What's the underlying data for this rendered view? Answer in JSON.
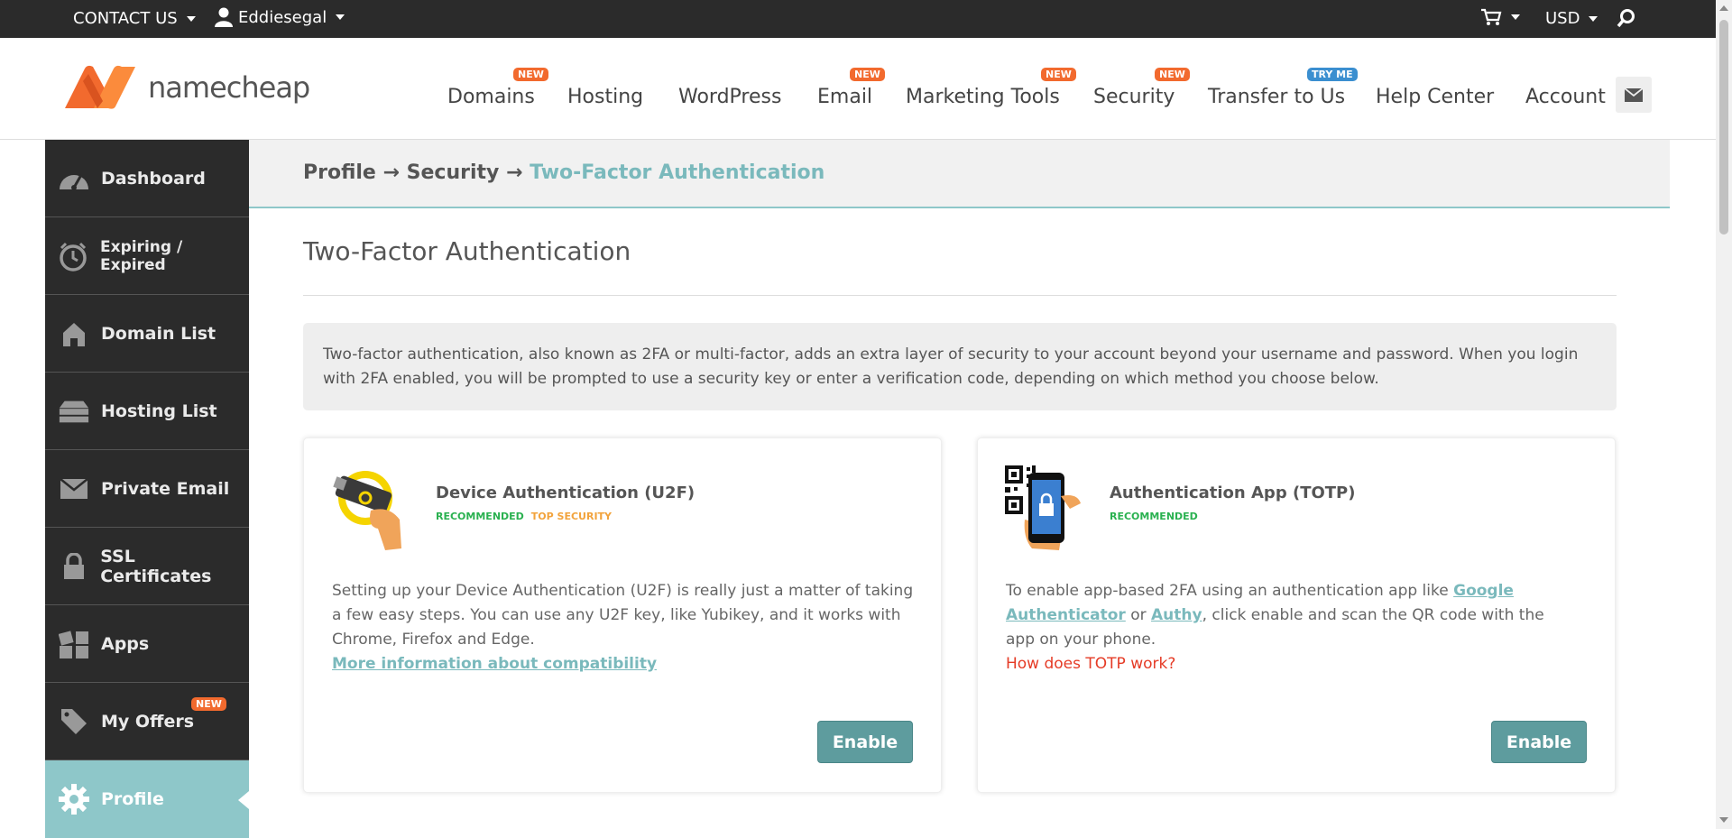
{
  "topbar": {
    "contact": "CONTACT US",
    "user": "Eddiesegal",
    "currency": "USD"
  },
  "brand": {
    "name": "namecheap"
  },
  "nav": [
    {
      "label": "Domains",
      "badge": "NEW"
    },
    {
      "label": "Hosting",
      "badge": ""
    },
    {
      "label": "WordPress",
      "badge": ""
    },
    {
      "label": "Email",
      "badge": "NEW"
    },
    {
      "label": "Marketing Tools",
      "badge": "NEW"
    },
    {
      "label": "Security",
      "badge": "NEW"
    },
    {
      "label": "Transfer to Us",
      "badge": "TRY ME"
    },
    {
      "label": "Help Center",
      "badge": ""
    },
    {
      "label": "Account",
      "badge": ""
    }
  ],
  "sidebar": {
    "items": [
      {
        "label": "Dashboard",
        "icon": "speedometer-icon"
      },
      {
        "label": "Expiring / Expired",
        "icon": "timer-icon"
      },
      {
        "label": "Domain List",
        "icon": "home-icon"
      },
      {
        "label": "Hosting List",
        "icon": "server-icon"
      },
      {
        "label": "Private Email",
        "icon": "envelope-icon"
      },
      {
        "label": "SSL Certificates",
        "icon": "lock-icon"
      },
      {
        "label": "Apps",
        "icon": "apps-icon"
      },
      {
        "label": "My Offers",
        "icon": "tag-icon",
        "badge": "NEW"
      },
      {
        "label": "Profile",
        "icon": "gear-icon"
      }
    ]
  },
  "breadcrumb": {
    "profile": "Profile",
    "security": "Security",
    "current": "Two-Factor Authentication",
    "arrow": "→"
  },
  "main": {
    "title": "Two-Factor Authentication",
    "intro": "Two-factor authentication, also known as 2FA or multi-factor, adds an extra layer of security to your account beyond your username and password. When you login with 2FA enabled, you will be prompted to use a security key or enter a verification code, depending on which method you choose below."
  },
  "cards": {
    "u2f": {
      "title": "Device Authentication (U2F)",
      "tag1": "RECOMMENDED",
      "tag2": "TOP SECURITY",
      "body": "Setting up your Device Authentication (U2F) is really just a matter of taking a few easy steps. You can use any U2F key, like Yubikey, and it works with Chrome, Firefox and Edge.",
      "link": "More information about compatibility",
      "button": "Enable"
    },
    "totp": {
      "title": "Authentication App (TOTP)",
      "tag1": "RECOMMENDED",
      "body_pre": "To enable app-based 2FA using an authentication app like ",
      "link_google": "Google Authenticator",
      "body_or": " or ",
      "link_authy": "Authy",
      "body_post": ", click enable and scan the QR code with the app on your phone.",
      "help": "How does TOTP work?",
      "button": "Enable"
    }
  },
  "colors": {
    "accent": "#8ec7c9",
    "brand_orange": "#f26a2e",
    "button": "#5e9c9e",
    "sidebar": "#2b2b2b"
  }
}
